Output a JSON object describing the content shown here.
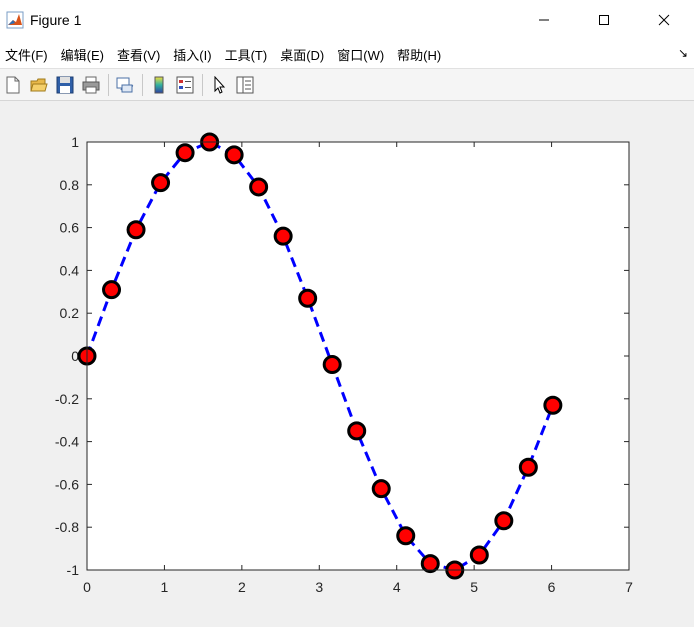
{
  "window": {
    "title": "Figure 1"
  },
  "menu": {
    "items": [
      "文件(F)",
      "编辑(E)",
      "查看(V)",
      "插入(I)",
      "工具(T)",
      "桌面(D)",
      "窗口(W)",
      "帮助(H)"
    ]
  },
  "toolbar": {
    "buttons": [
      "new-figure",
      "open-file",
      "save",
      "print",
      "link-plot",
      "colorbar",
      "legend",
      "pointer",
      "property-editor"
    ]
  },
  "colors": {
    "line": "#0000ff",
    "marker_face": "#ff0000",
    "marker_edge": "#000000"
  },
  "chart_data": {
    "type": "line",
    "x": [
      0,
      0.3167,
      0.6333,
      0.95,
      1.2667,
      1.5833,
      1.9,
      2.2167,
      2.5333,
      2.85,
      3.1667,
      3.4833,
      3.8,
      4.1167,
      4.4333,
      4.75,
      5.0667,
      5.3833,
      5.7,
      6.0167
    ],
    "series": [
      {
        "values": [
          0,
          0.31,
          0.59,
          0.81,
          0.95,
          1.0,
          0.94,
          0.79,
          0.56,
          0.27,
          -0.04,
          -0.35,
          -0.62,
          -0.84,
          -0.97,
          -1.0,
          -0.93,
          -0.77,
          -0.52,
          -0.23
        ]
      }
    ],
    "style": {
      "line": "dashed",
      "marker": "circle"
    },
    "xlim": [
      0,
      7
    ],
    "ylim": [
      -1,
      1
    ],
    "xticks": [
      "0",
      "1",
      "2",
      "3",
      "4",
      "5",
      "6",
      "7"
    ],
    "yticks": [
      "-1",
      "-0.8",
      "-0.6",
      "-0.4",
      "-0.2",
      "0",
      "0.2",
      "0.4",
      "0.6",
      "0.8",
      "1"
    ],
    "title": "",
    "xlabel": "",
    "ylabel": "",
    "grid": false
  }
}
